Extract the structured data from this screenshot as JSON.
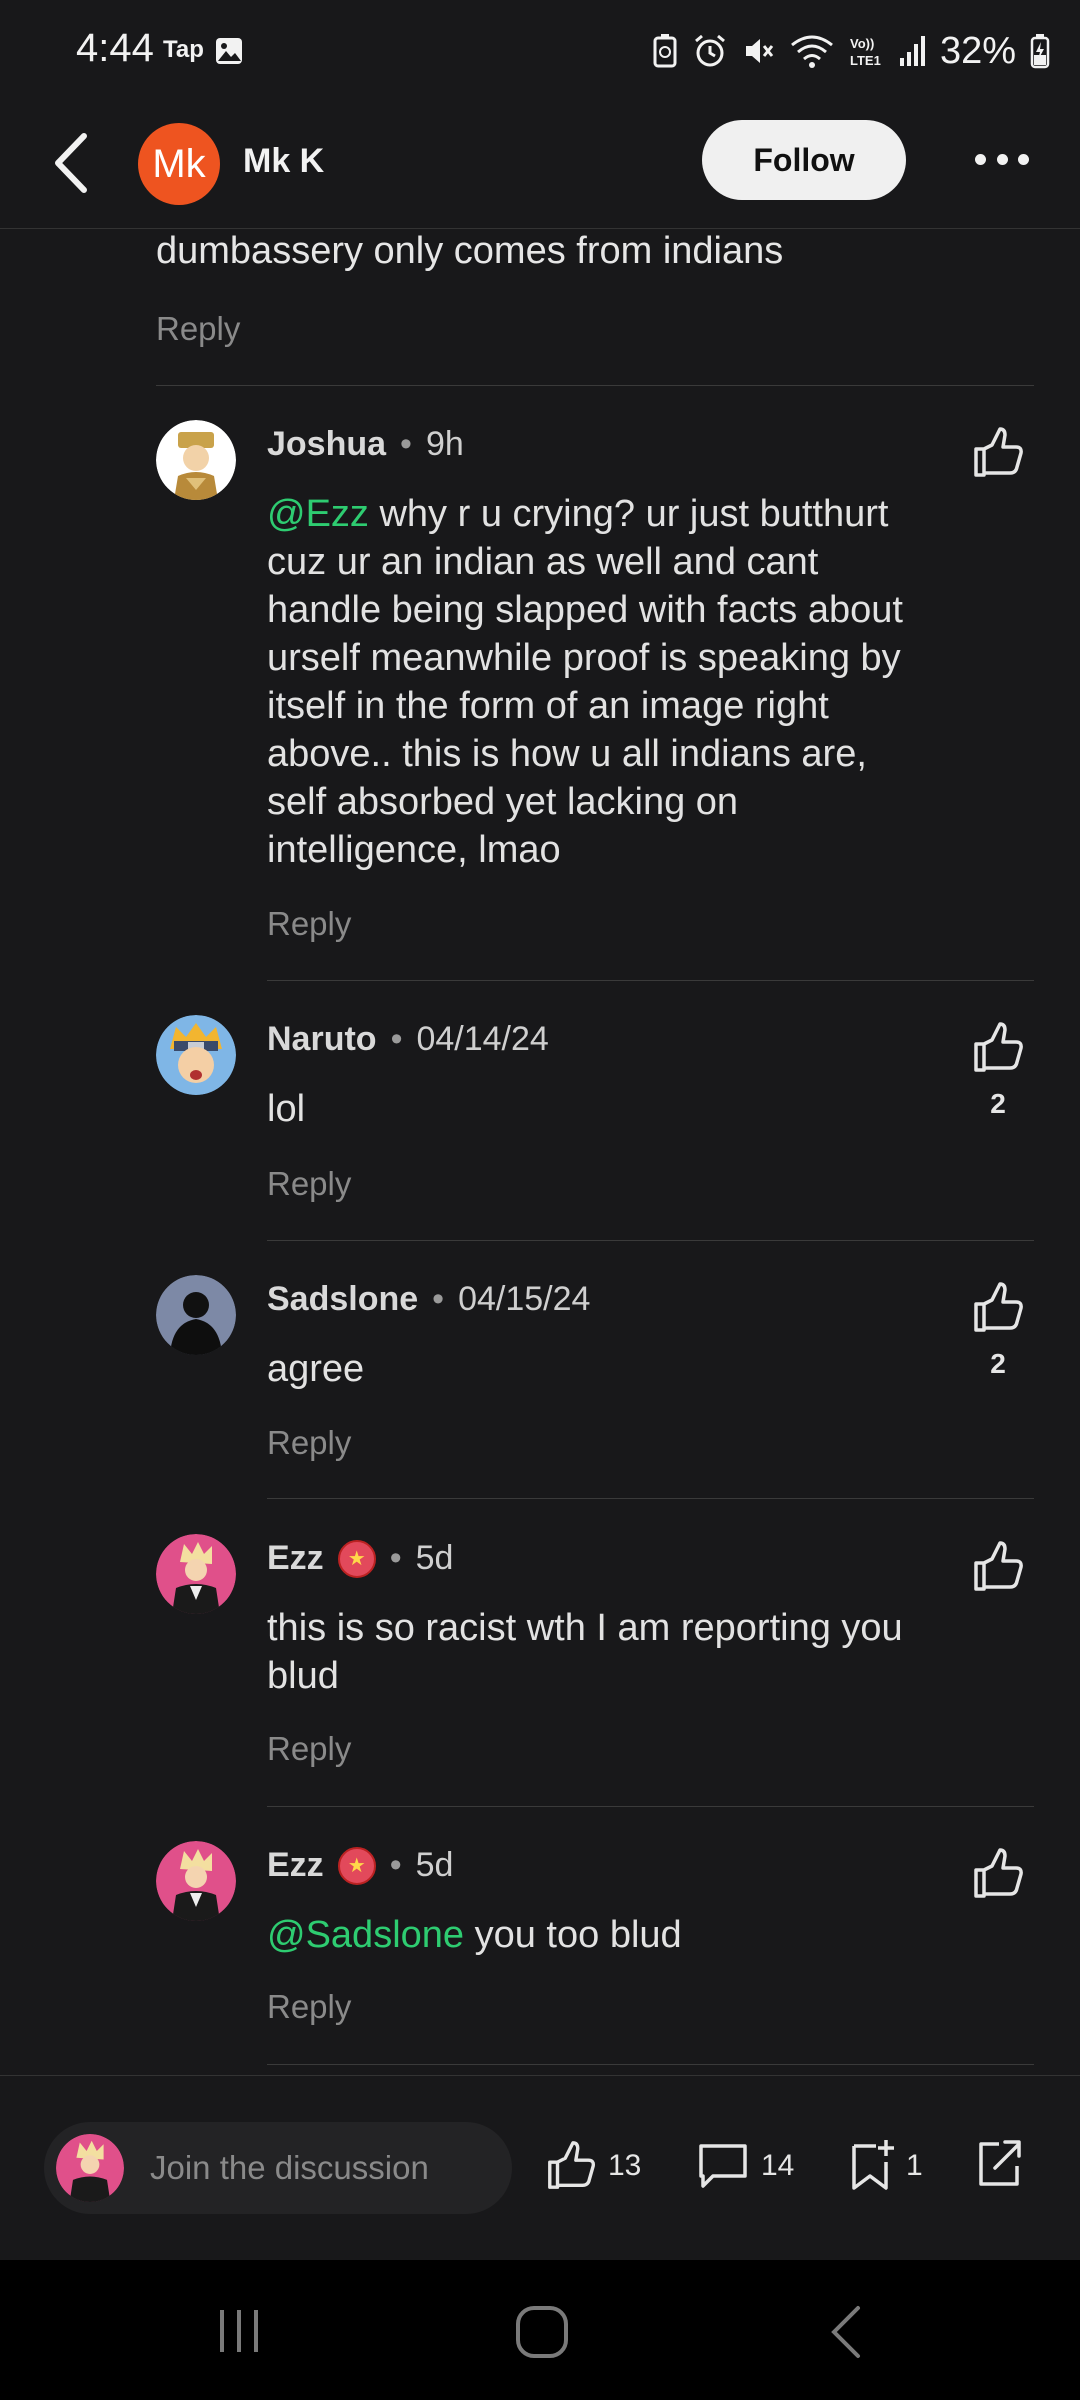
{
  "status_bar": {
    "time": "4:44",
    "tap_label": "Tap",
    "battery": "32%",
    "icons": [
      "gallery-icon",
      "recycle-icon",
      "alarm-icon",
      "mute-icon",
      "wifi-icon",
      "volte-icon",
      "signal-icon",
      "battery-icon"
    ]
  },
  "header": {
    "avatar_initials": "Mk",
    "name": "Mk K",
    "follow_label": "Follow"
  },
  "previous_comment": {
    "text": "dumbassery only comes from indians",
    "reply_label": "Reply"
  },
  "comments": [
    {
      "author": "Joshua",
      "time": "9h",
      "mention": "@Ezz",
      "text": " why r u crying? ur just butthurt cuz ur an indian as well and cant handle being slapped with facts about urself meanwhile proof is speaking by itself in the form of an image right above.. this is how u all indians are, self absorbed yet lacking on intelligence, lmao",
      "reply_label": "Reply",
      "likes": ""
    },
    {
      "author": "Naruto",
      "time": "04/14/24",
      "mention": "",
      "text": "lol",
      "reply_label": "Reply",
      "likes": "2"
    },
    {
      "author": "Sadslone",
      "time": "04/15/24",
      "mention": "",
      "text": "agree",
      "reply_label": "Reply",
      "likes": "2"
    },
    {
      "author": "Ezz",
      "time": "5d",
      "mention": "",
      "text": "this is so racist wth I am reporting you blud",
      "reply_label": "Reply",
      "likes": ""
    },
    {
      "author": "Ezz",
      "time": "5d",
      "mention": "@Sadslone",
      "text": " you too blud",
      "reply_label": "Reply",
      "likes": ""
    }
  ],
  "dot": "•",
  "bottom_bar": {
    "placeholder": "Join the discussion",
    "likes": "13",
    "comments": "14",
    "saves": "1"
  },
  "colors": {
    "background": "#18181a",
    "mention": "#2ecc71",
    "avatar_mk": "#ee5420"
  }
}
